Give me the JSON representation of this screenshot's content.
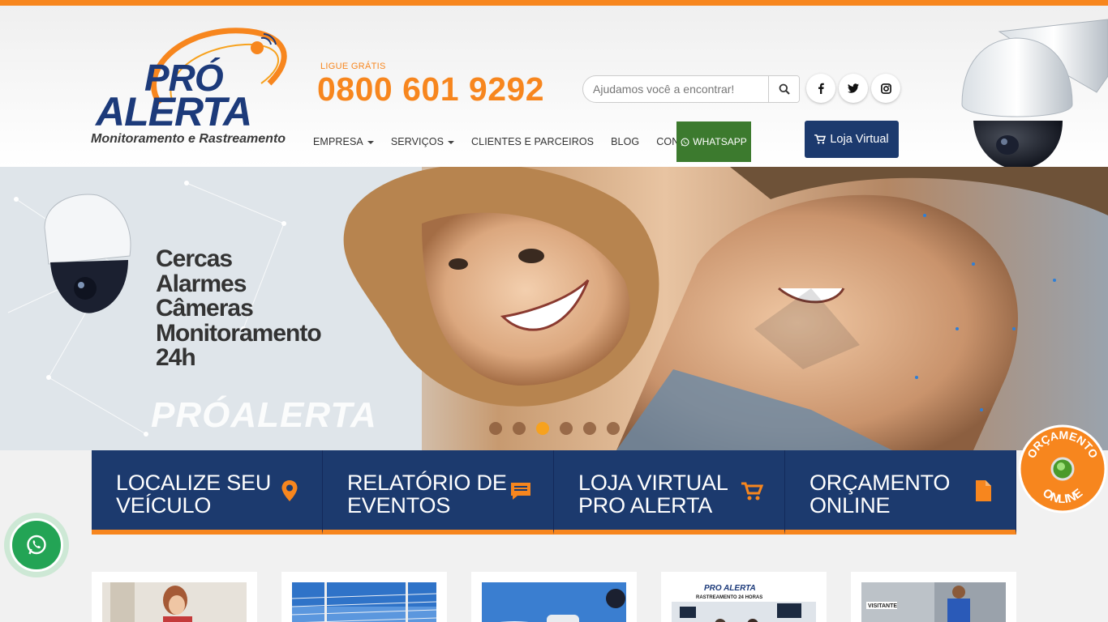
{
  "header": {
    "logo_line1": "PRÓ",
    "logo_line2": "ALERTA",
    "logo_tagline": "Monitoramento e Rastreamento",
    "call_label": "LIGUE GRÁTIS",
    "phone": "0800 601 9292",
    "search_placeholder": "Ajudamos você a encontrar!",
    "social": [
      "facebook-icon",
      "twitter-icon",
      "instagram-icon"
    ],
    "loja_label": "Loja Virtual"
  },
  "nav": {
    "items": [
      {
        "label": "EMPRESA",
        "dropdown": true
      },
      {
        "label": "SERVIÇOS",
        "dropdown": true
      },
      {
        "label": "CLIENTES E PARCEIROS",
        "dropdown": false
      },
      {
        "label": "BLOG",
        "dropdown": false
      },
      {
        "label": "CONTATO",
        "dropdown": false
      }
    ],
    "whatsapp_label": "WHATSAPP"
  },
  "hero": {
    "lines": [
      "Cercas",
      "Alarmes",
      "Câmeras",
      "Monitoramento",
      "24h"
    ],
    "brand": "PRÓALERTA",
    "slides": 6,
    "active_slide": 3
  },
  "tiles": [
    {
      "line1": "LOCALIZE SEU",
      "line2": "VEÍCULO",
      "icon": "map-pin-icon"
    },
    {
      "line1": "RELATÓRIO DE",
      "line2": "EVENTOS",
      "icon": "chat-icon"
    },
    {
      "line1": "LOJA VIRTUAL",
      "line2": "PRO ALERTA",
      "icon": "cart-icon"
    },
    {
      "line1": "ORÇAMENTO",
      "line2": "ONLINE",
      "icon": "document-icon"
    }
  ],
  "badge": {
    "top": "ORÇAMENTO",
    "bottom": "ONLINE"
  },
  "thumb_texts": {
    "t4_a": "PRO ALERTA",
    "t4_b": "RASTREAMENTO 24 HORAS",
    "t5": "VISITANTE"
  },
  "colors": {
    "orange": "#f7861e",
    "navy": "#1c3a6e",
    "green": "#3c7a2e",
    "whatsapp": "#23a455"
  }
}
